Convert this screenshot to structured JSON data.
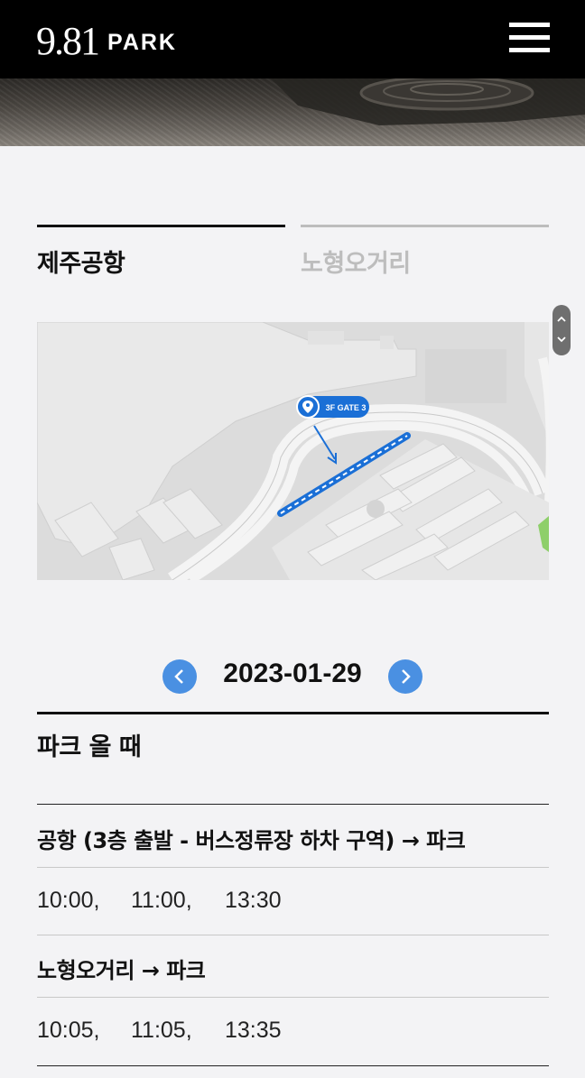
{
  "header": {
    "logo_number": "9.81",
    "logo_word": "PARK",
    "menu_icon": "hamburger-menu-icon"
  },
  "tabs": [
    {
      "label": "제주공항",
      "active": true
    },
    {
      "label": "노형오거리",
      "active": false
    }
  ],
  "map": {
    "marker_label": "3F GATE 3",
    "marker_icon": "location-pin-icon"
  },
  "date_nav": {
    "date": "2023-01-29",
    "prev_icon": "chevron-left-icon",
    "next_icon": "chevron-right-icon"
  },
  "schedule": {
    "section_title": "파크 올 때",
    "routes": [
      {
        "title": "공항 (3층 출발 - 버스정류장 하차 구역) → 파크",
        "times": [
          "10:00,",
          "11:00,",
          "13:30"
        ]
      },
      {
        "title": "노형오거리 → 파크",
        "times": [
          "10:05,",
          "11:05,",
          "13:35"
        ]
      }
    ]
  },
  "colors": {
    "header_bg": "#000000",
    "page_bg": "#f3f3f5",
    "accent_blue": "#4a90e2",
    "marker_blue": "#1a6fd6",
    "inactive_tab": "#bdbdbd"
  }
}
